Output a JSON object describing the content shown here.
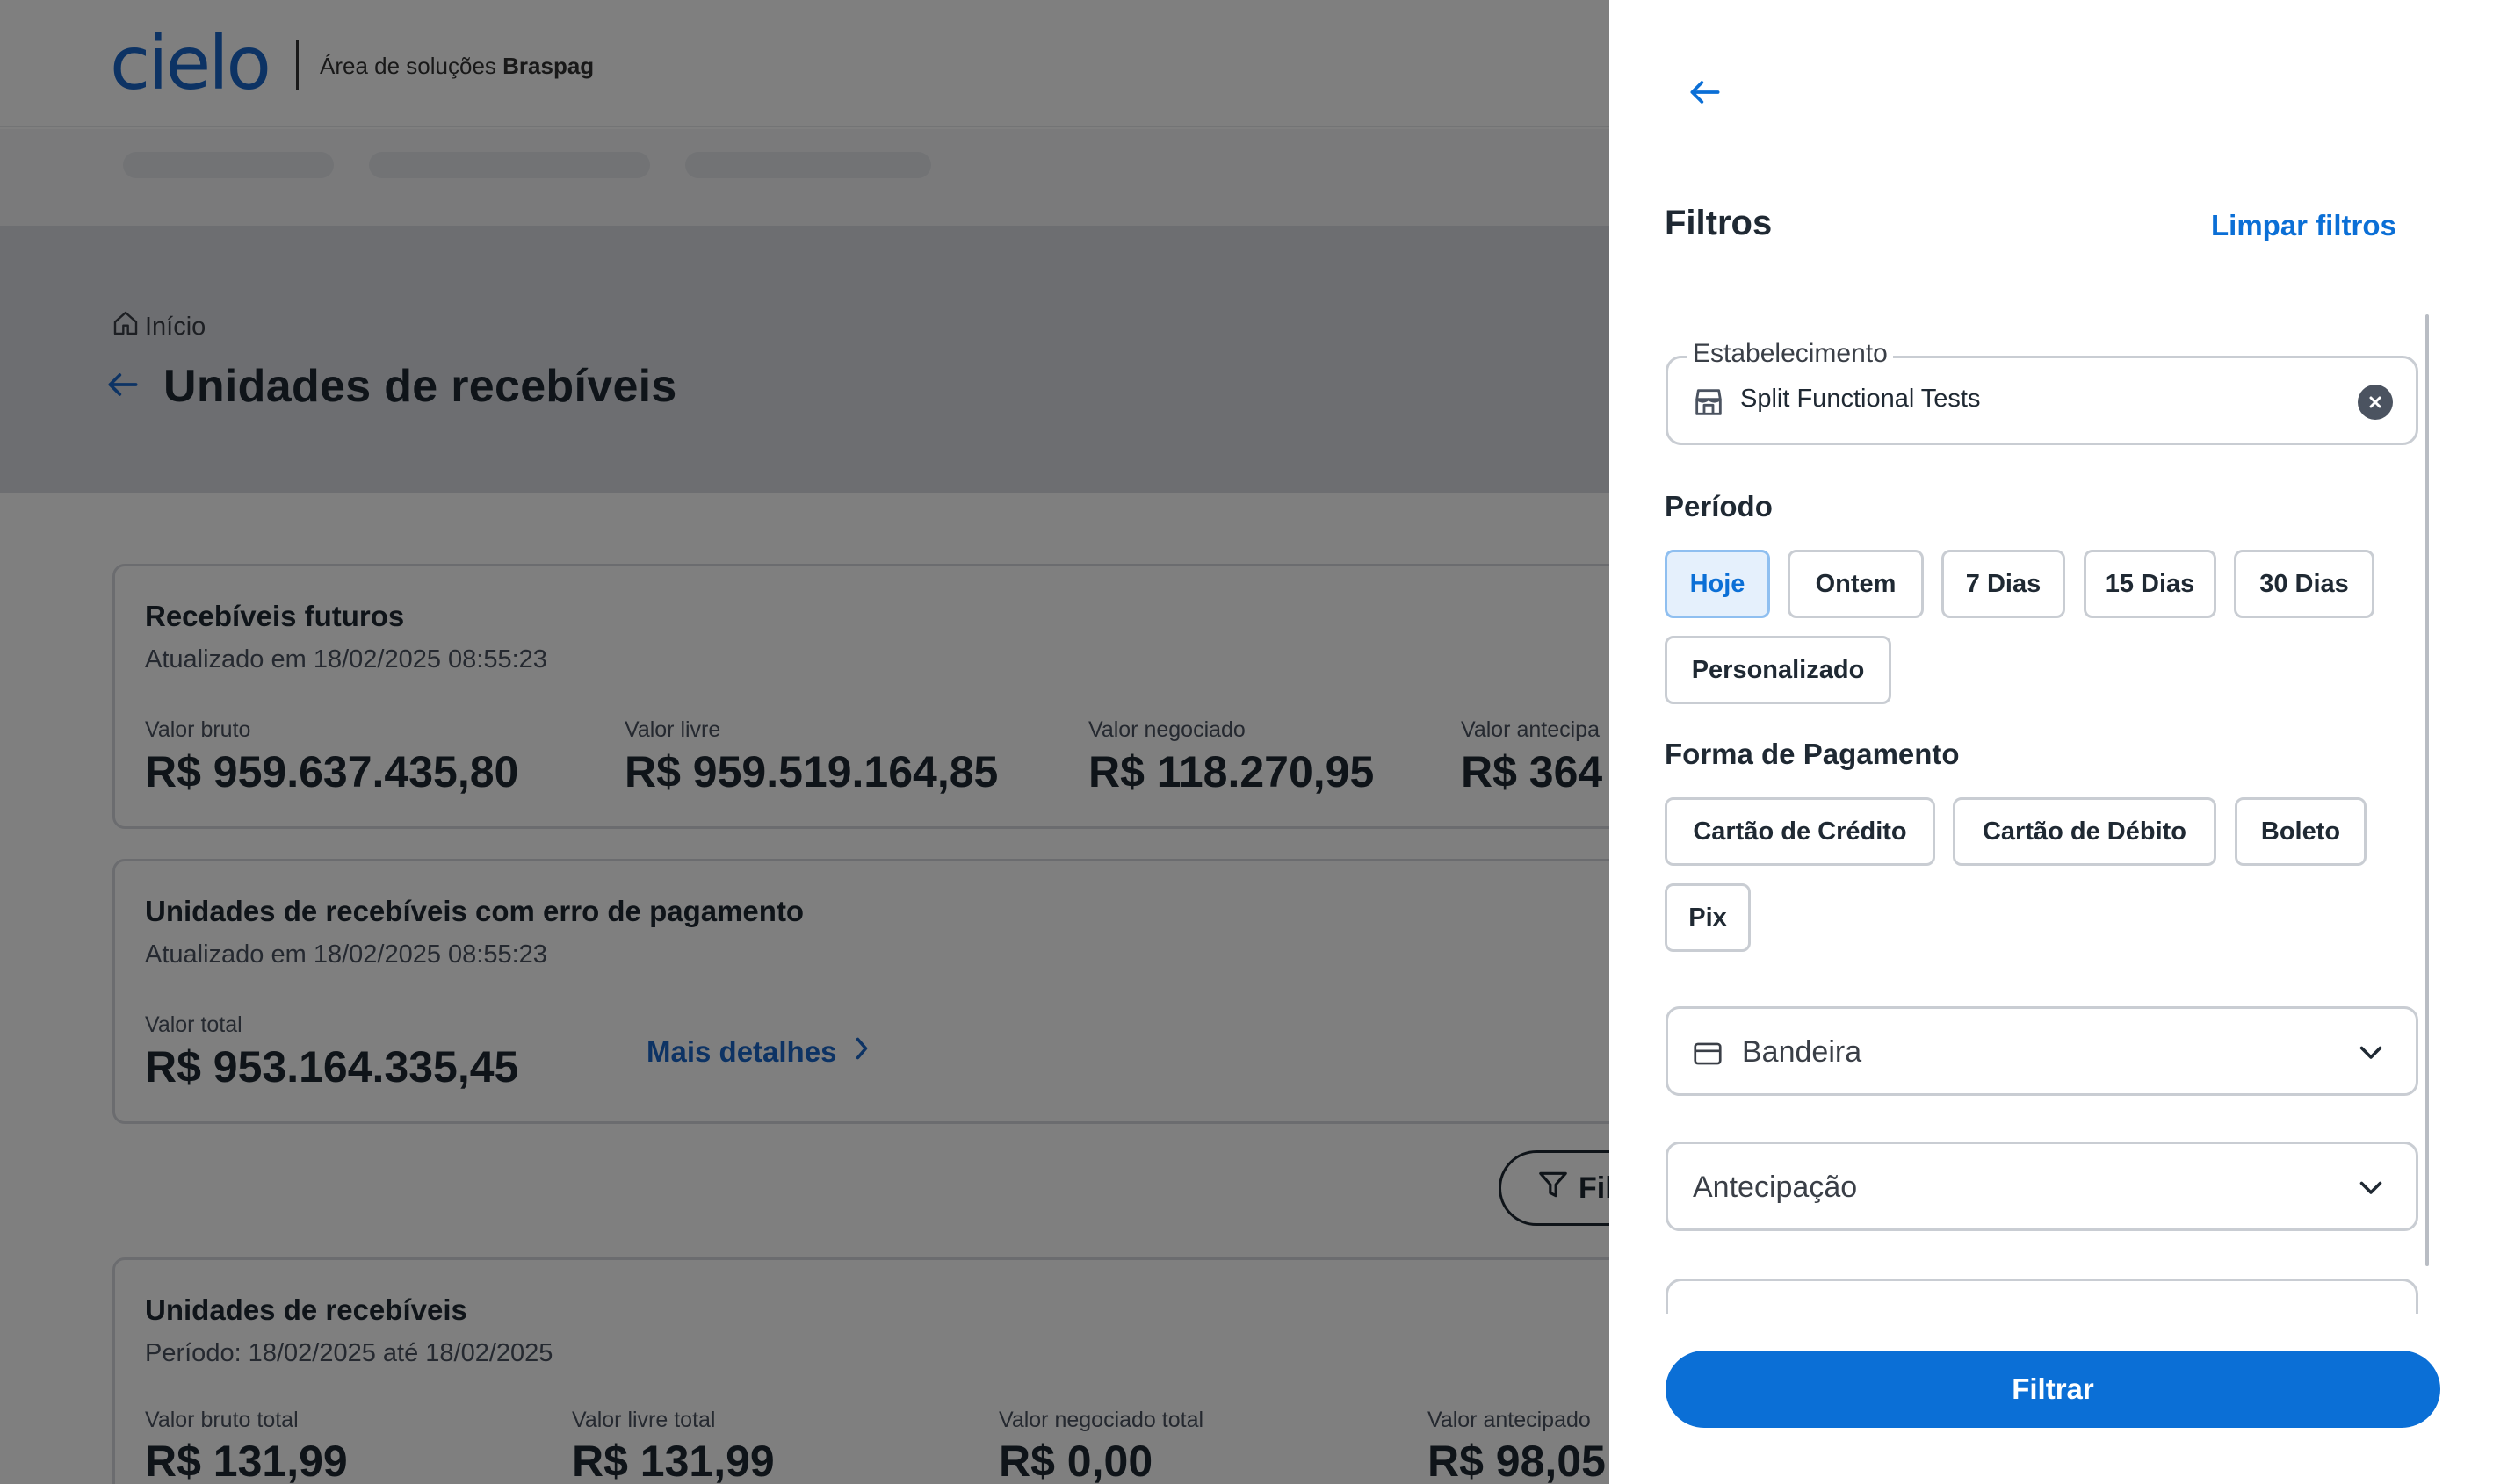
{
  "header": {
    "logo": "cielo",
    "area_prefix": "Área de soluções ",
    "area_brand": "Braspag"
  },
  "breadcrumb": {
    "home": "Início"
  },
  "page": {
    "title": "Unidades de recebíveis"
  },
  "card_future": {
    "title": "Recebíveis futuros",
    "updated": "Atualizado em 18/02/2025 08:55:23",
    "metrics": [
      {
        "label": "Valor bruto",
        "value": "R$ 959.637.435,80"
      },
      {
        "label": "Valor livre",
        "value": "R$ 959.519.164,85"
      },
      {
        "label": "Valor negociado",
        "value": "R$ 118.270,95"
      },
      {
        "label": "Valor antecipa",
        "value": "R$ 364"
      }
    ]
  },
  "card_error": {
    "title": "Unidades de recebíveis com erro de pagamento",
    "updated": "Atualizado em 18/02/2025 08:55:23",
    "total_label": "Valor total",
    "total_value": "R$ 953.164.335,45",
    "more_label": "Mais detalhes"
  },
  "filter_button": {
    "label": "Fil"
  },
  "card_units": {
    "title": "Unidades de recebíveis",
    "period": "Período: 18/02/2025 até 18/02/2025",
    "metrics": [
      {
        "label": "Valor bruto total",
        "value": "R$ 131,99"
      },
      {
        "label": "Valor livre total",
        "value": "R$ 131,99"
      },
      {
        "label": "Valor negociado total",
        "value": "R$ 0,00"
      },
      {
        "label": "Valor antecipado",
        "value": "R$ 98,05"
      }
    ]
  },
  "drawer": {
    "title": "Filtros",
    "clear_label": "Limpar filtros",
    "establishment": {
      "legend": "Estabelecimento",
      "value": "Split Functional Tests"
    },
    "period": {
      "label": "Período",
      "options": [
        "Hoje",
        "Ontem",
        "7 Dias",
        "15 Dias",
        "30 Dias",
        "Personalizado"
      ],
      "selected": "Hoje"
    },
    "payment": {
      "label": "Forma de Pagamento",
      "options": [
        "Cartão de Crédito",
        "Cartão de Débito",
        "Boleto",
        "Pix"
      ]
    },
    "flag_select": {
      "placeholder": "Bandeira"
    },
    "anticipation_select": {
      "placeholder": "Antecipação"
    },
    "submit_label": "Filtrar"
  },
  "colors": {
    "brand_blue": "#0b6fd6",
    "chip_active_bg": "#e5f0fc",
    "overlay": "rgba(0,0,0,0.5)"
  },
  "icons": {
    "back": "arrow-left-icon",
    "home": "home-icon",
    "store": "store-icon",
    "clear": "close-circle-icon",
    "card": "credit-card-icon",
    "chevron": "chevron-down-icon",
    "chevron_right": "chevron-right-icon",
    "filter": "filter-icon"
  }
}
